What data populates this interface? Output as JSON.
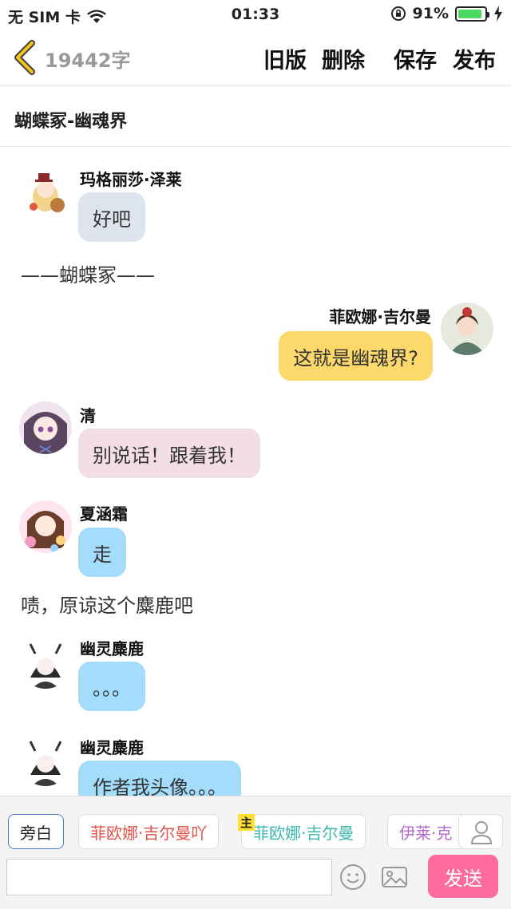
{
  "status_bar": {
    "carrier": "无 SIM 卡",
    "time": "01:33",
    "battery": "91%",
    "battery_level": 0.91
  },
  "header": {
    "word_count": "19442字",
    "old_version": "旧版",
    "delete": "删除",
    "save": "保存",
    "publish": "发布"
  },
  "chapter": {
    "title": "蝴蝶冢-幽魂界"
  },
  "messages": [
    {
      "speaker": "玛格丽莎·泽莱",
      "text": "好吧",
      "bubble_color": "#dde4ee"
    },
    {
      "narration": "——蝴蝶冢——"
    },
    {
      "speaker": "菲欧娜·吉尔曼",
      "text": "这就是幽魂界?",
      "bubble_color": "#fcd96a"
    },
    {
      "speaker": "清",
      "text": "别说话！跟着我！",
      "bubble_color": "#f3dfe3"
    },
    {
      "speaker": "夏涵霜",
      "text": "走",
      "bubble_color": "#a4dcfb"
    },
    {
      "narration": "啧，原谅这个麋鹿吧"
    },
    {
      "speaker": "幽灵麋鹿",
      "text": "。。。",
      "bubble_color": "#a4dcfb"
    },
    {
      "speaker": "幽灵麋鹿",
      "text": "作者我头像。。。",
      "bubble_color": "#a4dcfb"
    }
  ],
  "role_bar": {
    "roles": [
      {
        "label": "旁白",
        "color": "#222222"
      },
      {
        "label": "菲欧娜·吉尔曼吖",
        "color": "#e0534a"
      },
      {
        "label": "菲欧娜·吉尔曼",
        "color": "#3bb8b0"
      },
      {
        "label": "伊莱·克",
        "color": "#b46ac8"
      }
    ],
    "main_badge": "主",
    "user_icon": "user-icon"
  },
  "composer": {
    "placeholder": "",
    "emoji_icon": "smiley-icon",
    "image_icon": "image-icon",
    "send": "发送"
  },
  "colors": {
    "send": "#ff6b9e",
    "back_arrow": "#f5c518",
    "battery": "#4cd964"
  }
}
